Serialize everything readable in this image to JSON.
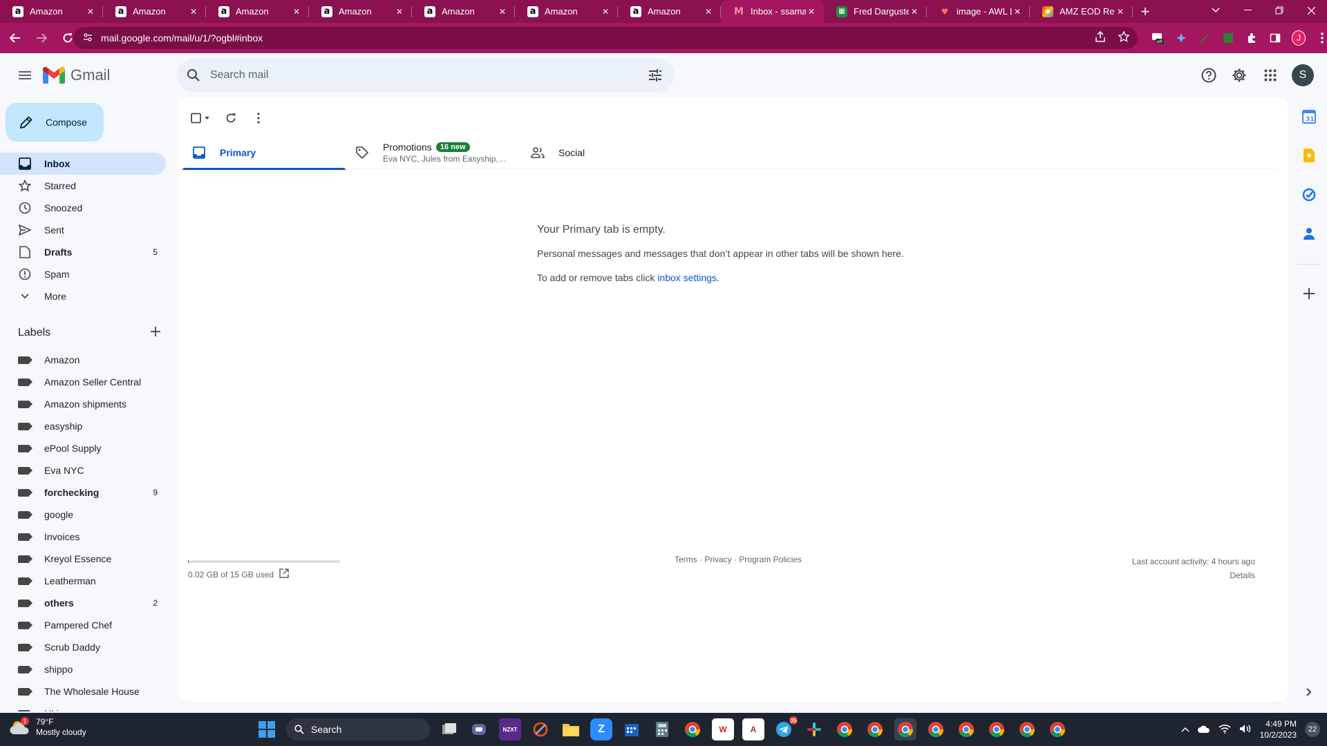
{
  "browser": {
    "tabs": [
      {
        "title": "Amazon",
        "icon": "amazon-icon",
        "active": false
      },
      {
        "title": "Amazon",
        "icon": "amazon-icon",
        "active": false
      },
      {
        "title": "Amazon",
        "icon": "amazon-icon",
        "active": false
      },
      {
        "title": "Amazon",
        "icon": "amazon-icon",
        "active": false
      },
      {
        "title": "Amazon",
        "icon": "amazon-icon",
        "active": false
      },
      {
        "title": "Amazon",
        "icon": "amazon-icon",
        "active": false
      },
      {
        "title": "Amazon",
        "icon": "amazon-icon",
        "active": false
      },
      {
        "title": "Inbox - ssamaz",
        "icon": "gmail-icon",
        "active": true
      },
      {
        "title": "Fred Darguste",
        "icon": "sheets-icon",
        "active": false
      },
      {
        "title": "image - AWL L",
        "icon": "image-icon",
        "active": false
      },
      {
        "title": "AMZ EOD Repo",
        "icon": "amz-eod-icon",
        "active": false
      }
    ],
    "url": "mail.google.com/mail/u/1/?ogbl#inbox",
    "profile_initial": "J",
    "theme_color": "#a4165f"
  },
  "gmail": {
    "brand": "Gmail",
    "search_placeholder": "Search mail",
    "avatar_initial": "S",
    "compose_label": "Compose",
    "nav": [
      {
        "label": "Inbox",
        "icon": "inbox-icon",
        "count": "",
        "active": true,
        "bold": true
      },
      {
        "label": "Starred",
        "icon": "star-icon",
        "count": "",
        "active": false,
        "bold": false
      },
      {
        "label": "Snoozed",
        "icon": "clock-icon",
        "count": "",
        "active": false,
        "bold": false
      },
      {
        "label": "Sent",
        "icon": "send-icon",
        "count": "",
        "active": false,
        "bold": false
      },
      {
        "label": "Drafts",
        "icon": "draft-icon",
        "count": "5",
        "active": false,
        "bold": true
      },
      {
        "label": "Spam",
        "icon": "spam-icon",
        "count": "",
        "active": false,
        "bold": false
      },
      {
        "label": "More",
        "icon": "chevron-down-icon",
        "count": "",
        "active": false,
        "bold": false
      }
    ],
    "labels_title": "Labels",
    "labels": [
      {
        "name": "Amazon",
        "count": "",
        "bold": false
      },
      {
        "name": "Amazon Seller Central",
        "count": "",
        "bold": false
      },
      {
        "name": "Amazon shipments",
        "count": "",
        "bold": false
      },
      {
        "name": "easyship",
        "count": "",
        "bold": false
      },
      {
        "name": "ePool Supply",
        "count": "",
        "bold": false
      },
      {
        "name": "Eva NYC",
        "count": "",
        "bold": false
      },
      {
        "name": "forchecking",
        "count": "9",
        "bold": true
      },
      {
        "name": "google",
        "count": "",
        "bold": false
      },
      {
        "name": "Invoices",
        "count": "",
        "bold": false
      },
      {
        "name": "Kreyol Essence",
        "count": "",
        "bold": false
      },
      {
        "name": "Leatherman",
        "count": "",
        "bold": false
      },
      {
        "name": "others",
        "count": "2",
        "bold": true
      },
      {
        "name": "Pampered Chef",
        "count": "",
        "bold": false
      },
      {
        "name": "Scrub Daddy",
        "count": "",
        "bold": false
      },
      {
        "name": "shippo",
        "count": "",
        "bold": false
      },
      {
        "name": "The Wholesale House",
        "count": "",
        "bold": false
      },
      {
        "name": "ULine",
        "count": "",
        "bold": false
      }
    ],
    "category_tabs": {
      "primary": "Primary",
      "promotions": "Promotions",
      "promotions_badge": "16 new",
      "promotions_senders": "Eva NYC, Jules from Easyship, L...",
      "social": "Social"
    },
    "empty_state": {
      "title": "Your Primary tab is empty.",
      "line1": "Personal messages and messages that don’t appear in other tabs will be shown here.",
      "line2_prefix": "To add or remove tabs click ",
      "line2_link": "inbox settings",
      "line2_suffix": "."
    },
    "footer": {
      "storage_used_fraction": 0.0013,
      "storage_text": "0.02 GB of 15 GB used",
      "links": "Terms · Privacy · Program Policies",
      "last_activity": "Last account activity: 4 hours ago",
      "details": "Details"
    }
  },
  "taskbar": {
    "weather_temp": "79°F",
    "weather_desc": "Mostly cloudy",
    "weather_badge": "1",
    "search_label": "Search",
    "time": "4:49 PM",
    "date": "10/2/2023",
    "notification_count": "22",
    "telegram_badge": "35"
  }
}
